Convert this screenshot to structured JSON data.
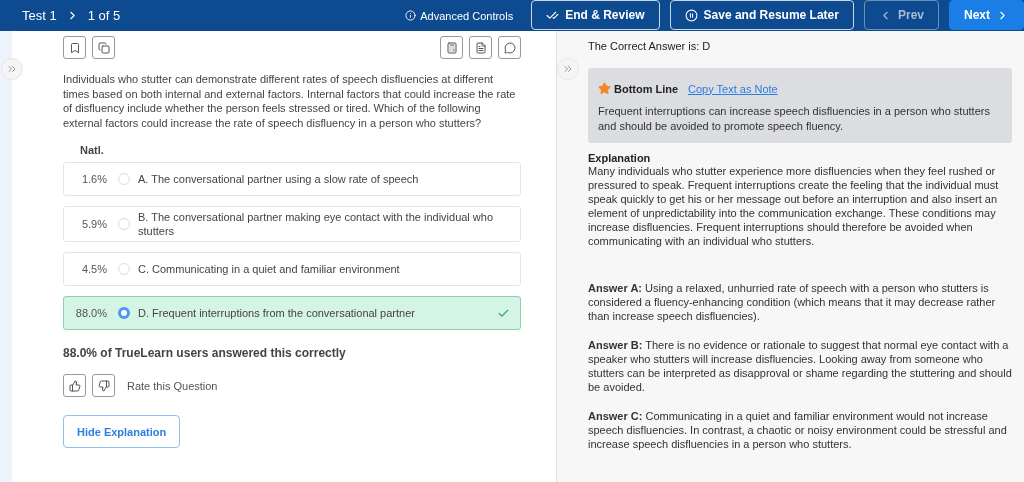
{
  "header": {
    "test": "Test 1",
    "progress": "1 of 5",
    "advanced": "Advanced Controls",
    "end_review": "End & Review",
    "save": "Save and Resume Later",
    "prev": {
      "label": "Prev",
      "disabled": true
    },
    "next": {
      "label": "Next",
      "disabled": false
    }
  },
  "question": {
    "text": "Individuals who stutter can demonstrate different rates of speech disfluencies at different times based on both internal and external factors. Internal factors that could increase the rate of disfluency include whether the person feels stressed or tired. Which of the following external factors could increase the rate of speech disfluency in a person who stutters?",
    "natl_label": "Natl.",
    "choices": [
      {
        "pct": "1.6%",
        "text": "A. The conversational partner using a slow rate of speech",
        "selected": false,
        "correct": false
      },
      {
        "pct": "5.9%",
        "text": "B. The conversational partner making eye contact with the individual who stutters",
        "selected": false,
        "correct": false
      },
      {
        "pct": "4.5%",
        "text": "C. Communicating in a quiet and familiar environment",
        "selected": false,
        "correct": false
      },
      {
        "pct": "88.0%",
        "text": "D. Frequent interruptions from the conversational partner",
        "selected": true,
        "correct": true
      }
    ],
    "stats": "88.0% of TrueLearn users answered this correctly",
    "rate": "Rate this Question",
    "hide_button": "Hide Explanation"
  },
  "answer": {
    "correct": "The Correct Answer is: D",
    "bottom_title": "Bottom Line",
    "copy_link": "Copy Text as Note",
    "bottom_text": "Frequent interruptions can increase speech disfluencies in a person who stutters and should be avoided to promote speech fluency.",
    "explanation_title": "Explanation",
    "explanation": "Many individuals who stutter experience more disfluencies when they feel rushed or pressured to speak. Frequent interruptions create the feeling that the individual must speak quickly to get his or her message out before an interruption and also insert an element of unpredictability into the communication exchange. These conditions may increase disfluencies. Frequent interruptions should therefore be avoided when communicating with an individual who stutters.",
    "details": [
      "**Answer A:** Using a relaxed, unhurried rate of speech with a person who stutters is considered a fluency-enhancing condition (which means that it may decrease rather than increase speech disfluencies).",
      "**Answer B:** There is no evidence or rationale to suggest that normal eye contact with a speaker who stutters will increase disfluencies. Looking away from someone who stutters can be interpreted as disapproval or shame regarding the stuttering and should be avoided.",
      "**Answer C:** Communicating in a quiet and familiar environment would not increase speech disfluencies. In contrast, a chaotic or noisy environment could be stressful and increase speech disfluencies in a person who stutters."
    ]
  }
}
